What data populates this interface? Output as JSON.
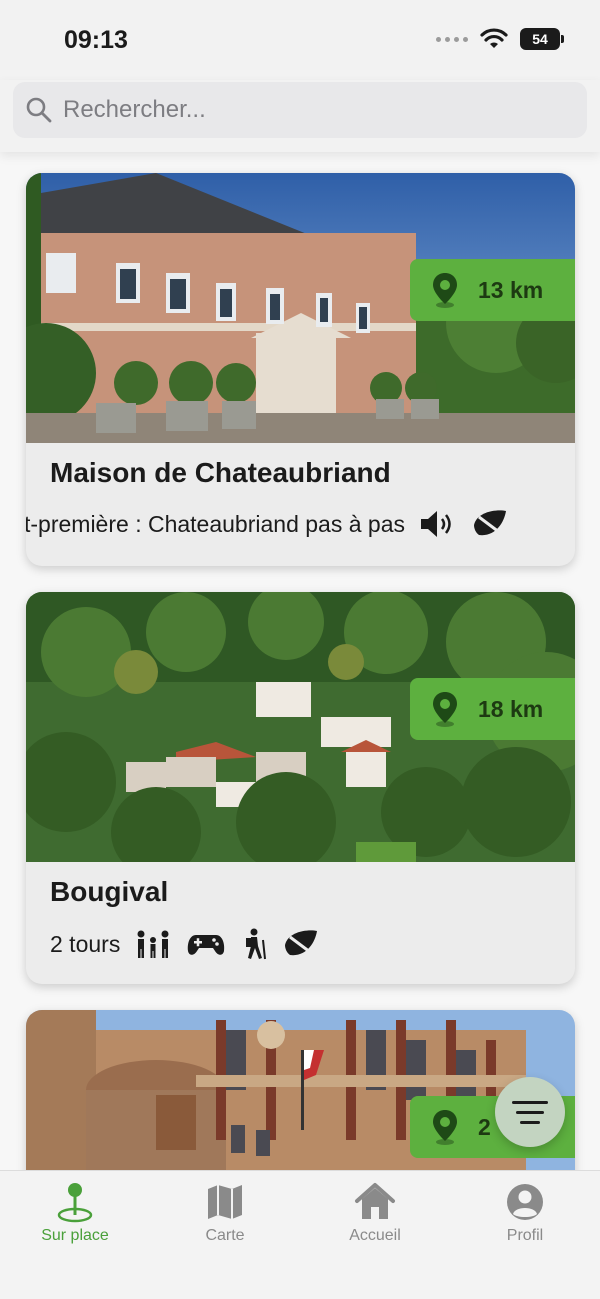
{
  "status_bar": {
    "time": "09:13",
    "battery": "54"
  },
  "search": {
    "placeholder": "Rechercher..."
  },
  "cards": [
    {
      "title": "Maison de Chateaubriand",
      "subtitle": "t-première : Chateaubriand pas à pas",
      "distance": "13 km",
      "icons": [
        "audio-icon",
        "leaf-icon"
      ]
    },
    {
      "title": "Bougival",
      "subtitle": "2 tours",
      "distance": "18 km",
      "icons": [
        "family-icon",
        "gamepad-icon",
        "hiker-icon",
        "leaf-icon"
      ]
    },
    {
      "title": "",
      "subtitle": "",
      "distance": "2",
      "icons": []
    }
  ],
  "tabs": [
    {
      "label": "Sur place",
      "icon": "location-pin-icon",
      "active": true
    },
    {
      "label": "Carte",
      "icon": "map-icon",
      "active": false
    },
    {
      "label": "Accueil",
      "icon": "home-icon",
      "active": false
    },
    {
      "label": "Profil",
      "icon": "profile-icon",
      "active": false
    }
  ],
  "colors": {
    "accent": "#5db03f",
    "active_tab": "#4aa03a",
    "inactive_tab": "#8a8a8a",
    "fab": "#c3d4c1"
  }
}
